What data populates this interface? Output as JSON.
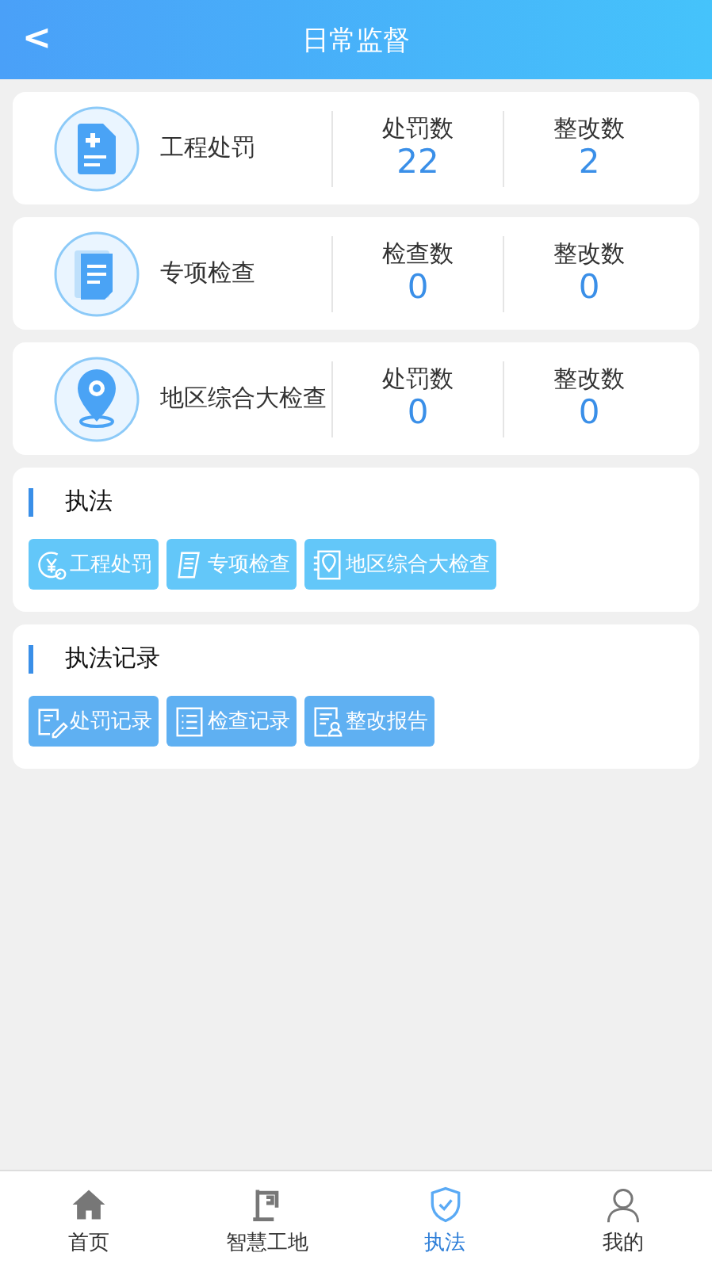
{
  "header": {
    "back": "<",
    "title": "日常监督"
  },
  "summary_cards": [
    {
      "name": "工程处罚",
      "stats": [
        {
          "label": "处罚数",
          "value": "22"
        },
        {
          "label": "整改数",
          "value": "2"
        }
      ]
    },
    {
      "name": "专项检查",
      "stats": [
        {
          "label": "检查数",
          "value": "0"
        },
        {
          "label": "整改数",
          "value": "0"
        }
      ]
    },
    {
      "name": "地区综合大检查",
      "stats": [
        {
          "label": "处罚数",
          "value": "0"
        },
        {
          "label": "整改数",
          "value": "0"
        }
      ]
    }
  ],
  "sections": [
    {
      "title": "执法",
      "buttons": [
        {
          "label": "工程处罚"
        },
        {
          "label": "专项检查"
        },
        {
          "label": "地区综合大检查"
        }
      ]
    },
    {
      "title": "执法记录",
      "buttons": [
        {
          "label": "处罚记录"
        },
        {
          "label": "检查记录"
        },
        {
          "label": "整改报告"
        }
      ]
    }
  ],
  "tab_bar": [
    {
      "label": "首页",
      "selected": false
    },
    {
      "label": "智慧工地",
      "selected": false
    },
    {
      "label": "执法",
      "selected": true
    },
    {
      "label": "我的",
      "selected": false
    }
  ]
}
